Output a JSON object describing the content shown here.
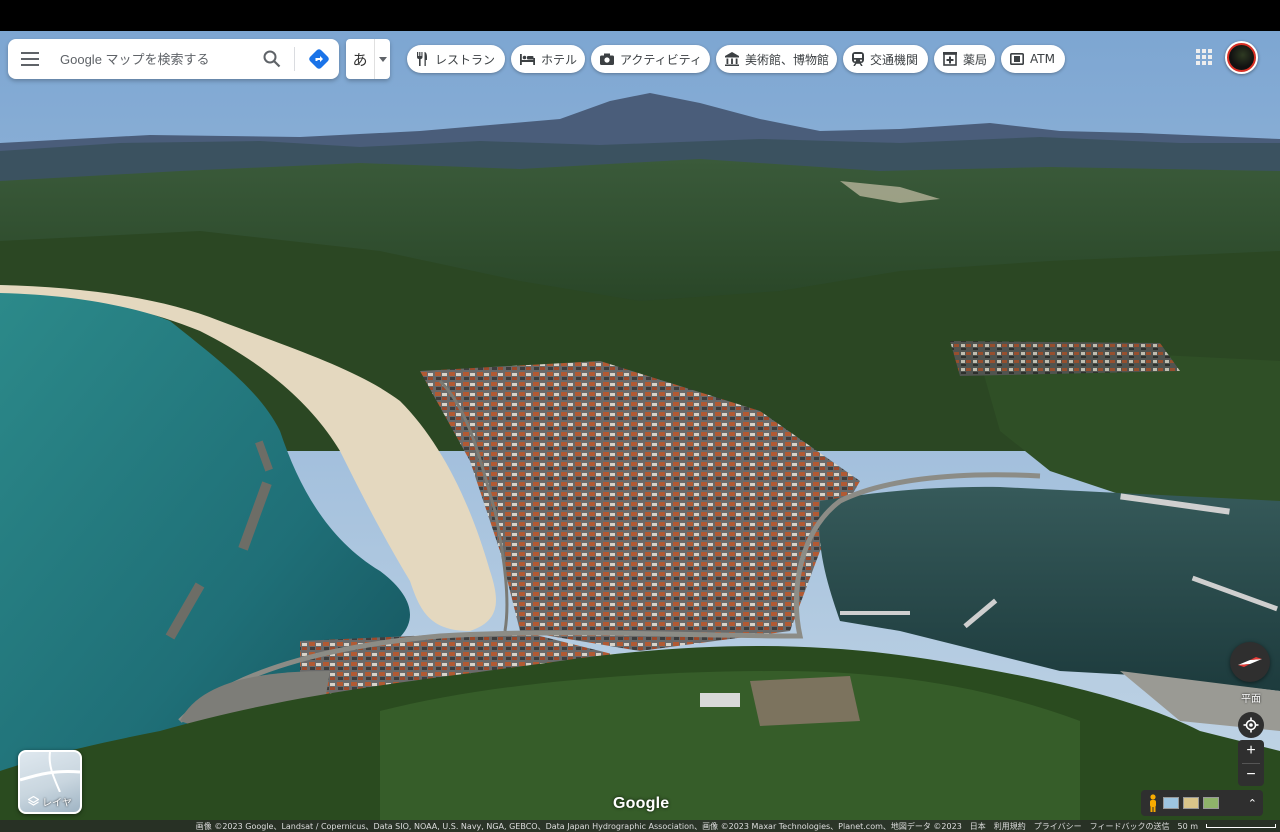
{
  "search": {
    "placeholder": "Google マップを検索する",
    "value": ""
  },
  "ime": {
    "label": "あ"
  },
  "chips": [
    {
      "id": "restaurant",
      "label": "レストラン",
      "icon": "fork-knife-icon"
    },
    {
      "id": "hotel",
      "label": "ホテル",
      "icon": "bed-icon"
    },
    {
      "id": "activity",
      "label": "アクティビティ",
      "icon": "camera-icon"
    },
    {
      "id": "museum",
      "label": "美術館、博物館",
      "icon": "museum-icon"
    },
    {
      "id": "transit",
      "label": "交通機関",
      "icon": "train-icon"
    },
    {
      "id": "pharmacy",
      "label": "薬局",
      "icon": "pharmacy-icon"
    },
    {
      "id": "atm",
      "label": "ATM",
      "icon": "atm-icon"
    }
  ],
  "controls": {
    "flat_label": "平面",
    "zoom_in": "+",
    "zoom_out": "−"
  },
  "layers": {
    "label": "レイヤ"
  },
  "logo": "Google",
  "attribution": {
    "imagery": "画像 ©2023 Google、Landsat / Copernicus、Data SIO, NOAA, U.S. Navy, NGA, GEBCO、Data Japan Hydrographic Association、画像 ©2023 Maxar Technologies、Planet.com、地図データ ©2023",
    "region": "日本",
    "terms": "利用規約",
    "privacy": "プライバシー",
    "feedback": "フィードバックの送信",
    "scale": "50 m"
  },
  "colors": {
    "sky": "#9ab9d8",
    "sea": "#2f8a8c",
    "forest": "#2c4a22",
    "beach": "#e2d6bd",
    "directions_accent": "#1a73e8"
  }
}
